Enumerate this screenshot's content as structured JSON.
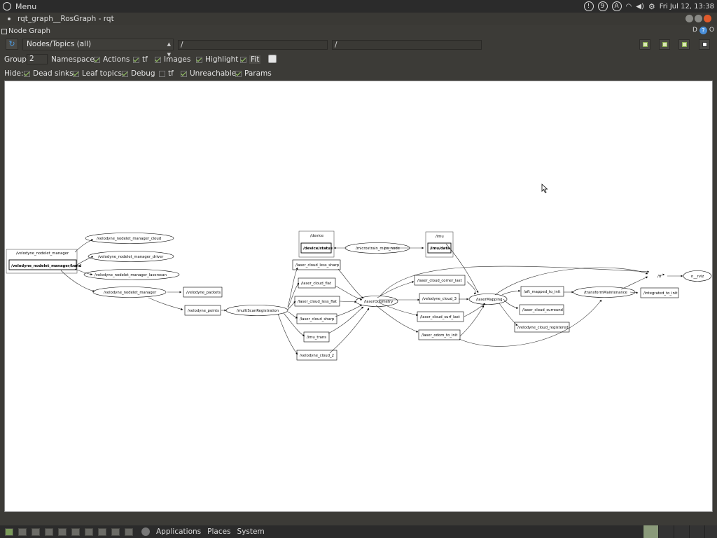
{
  "top_panel": {
    "menu_label": "Menu",
    "tray_badges": [
      "!",
      "9",
      "A"
    ],
    "clock": "Fri Jul 12, 13:38"
  },
  "window": {
    "title": "rqt_graph__RosGraph - rqt"
  },
  "dock": {
    "title": "Node Graph",
    "right_letters": "D",
    "right_extra": "O"
  },
  "toolbar": {
    "mode_selected": "Nodes/Topics (all)",
    "node_filter": "/",
    "topic_filter": "/"
  },
  "group_row": {
    "group_label": "Group:",
    "group_value": "2",
    "options": [
      {
        "label": "Namespaces",
        "checked": true
      },
      {
        "label": "Actions",
        "checked": true
      },
      {
        "label": "tf",
        "checked": true
      },
      {
        "label": "Images",
        "checked": true
      },
      {
        "label": "Highlight",
        "checked": true
      },
      {
        "label": "Fit",
        "checked": true
      }
    ]
  },
  "hide_row": {
    "hide_label": "Hide:",
    "options": [
      {
        "label": "Dead sinks",
        "checked": true
      },
      {
        "label": "Leaf topics",
        "checked": true
      },
      {
        "label": "Debug",
        "checked": true
      },
      {
        "label": "tf",
        "checked": false
      },
      {
        "label": "Unreachable",
        "checked": true
      },
      {
        "label": "Params",
        "checked": true
      }
    ]
  },
  "graph": {
    "nodes": {
      "mgr_group": "/velodyne_nodelet_manager",
      "mgr_bond": "/velodyne_nodelet_manager/bond",
      "cloud": "/velodyne_nodelet_manager_cloud",
      "driver": "/velodyne_nodelet_manager_driver",
      "laserscan": "/velodyne_nodelet_manager_laserscan",
      "nodelet_mgr": "/velodyne_nodelet_manager",
      "packets": "/velodyne_packets",
      "points": "/velodyne_points",
      "multiscan": "/multiScanRegistration",
      "device_group": "/device",
      "device_status": "/device/status",
      "microstrain": "/microstrain_mips_node",
      "imu_group": "/imu",
      "imu_data": "/imu/data",
      "less_sharp": "/laser_cloud_less_sharp",
      "flat": "/laser_cloud_flat",
      "less_flat": "/laser_cloud_less_flat",
      "sharp": "/laser_cloud_sharp",
      "imu_trans": "/imu_trans",
      "vcloud2": "/velodyne_cloud_2",
      "laserodom": "/laserOdometry",
      "corner_last": "/laser_cloud_corner_last",
      "vcloud3": "/velodyne_cloud_3",
      "surf_last": "/laser_cloud_surf_last",
      "odom_to_init": "/laser_odom_to_init",
      "lasermapping": "/laserMapping",
      "aft_mapped": "/aft_mapped_to_init",
      "surround": "/laser_cloud_surround",
      "registered": "/velodyne_cloud_registered",
      "transform": "/transformMaintenance",
      "integrated": "/integrated_to_init",
      "tf": "/tf",
      "rviz": "n__rviz"
    }
  },
  "taskbar": {
    "applications": "Applications",
    "places": "Places",
    "system": "System"
  }
}
